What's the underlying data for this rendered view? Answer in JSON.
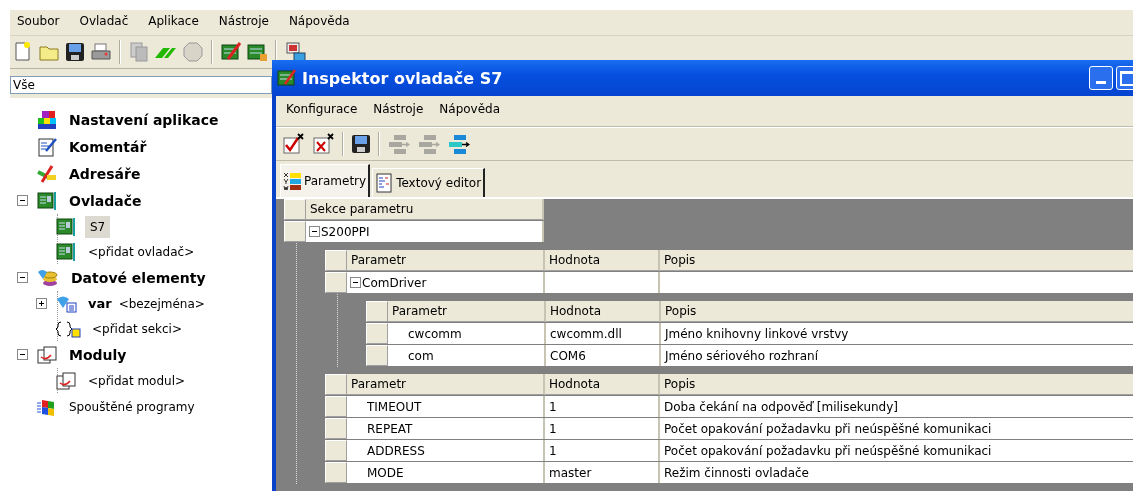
{
  "menu": [
    "Soubor",
    "Ovladač",
    "Aplikace",
    "Nástroje",
    "Nápověda"
  ],
  "toolbar": [
    {
      "kind": "new",
      "disabled": false
    },
    {
      "kind": "open",
      "disabled": false
    },
    {
      "kind": "save",
      "disabled": false
    },
    {
      "kind": "print",
      "disabled": false
    },
    {
      "kind": "separator"
    },
    {
      "kind": "copy",
      "disabled": true
    },
    {
      "kind": "run",
      "disabled": false
    },
    {
      "kind": "stop",
      "disabled": true
    },
    {
      "kind": "separator"
    },
    {
      "kind": "board-edit",
      "disabled": false
    },
    {
      "kind": "board-lock",
      "disabled": false
    },
    {
      "kind": "separator"
    },
    {
      "kind": "monitor",
      "disabled": false
    }
  ],
  "filter": {
    "value": "Vše"
  },
  "tree": [
    {
      "label": "Nastavení aplikace",
      "kind": "settings",
      "bold": true,
      "selected": false
    },
    {
      "label": "Komentář",
      "kind": "comment",
      "bold": true,
      "selected": false
    },
    {
      "label": "Adresáře",
      "kind": "directories",
      "bold": true,
      "selected": false
    },
    {
      "label": "Ovladače",
      "kind": "board",
      "bold": true,
      "selected": false,
      "expanded": true,
      "children": [
        {
          "label": "S7",
          "kind": "board",
          "bold": false,
          "selected": true
        },
        {
          "label": "<přidat ovladač>",
          "kind": "board",
          "bold": false,
          "selected": false
        }
      ]
    },
    {
      "label": "Datové elementy",
      "kind": "data",
      "bold": true,
      "selected": false,
      "expanded": true,
      "children": [
        {
          "label": "var",
          "note": "<bezejména>",
          "kind": "variable",
          "bold": true,
          "selected": false,
          "expanded": false
        },
        {
          "label": "<přidat sekci>",
          "kind": "section",
          "bold": false,
          "selected": false
        }
      ]
    },
    {
      "label": "Moduly",
      "kind": "module",
      "bold": true,
      "selected": false,
      "expanded": true,
      "children": [
        {
          "label": "<přidat modul>",
          "kind": "module",
          "bold": false,
          "selected": false
        }
      ]
    },
    {
      "label": "Spouštěné programy",
      "kind": "programs",
      "bold": false,
      "selected": false
    }
  ],
  "inspector": {
    "title": "Inspektor ovladače S7",
    "menu": [
      "Konfigurace",
      "Nástroje",
      "Nápověda"
    ],
    "toolbar": [
      {
        "kind": "check",
        "disabled": false
      },
      {
        "kind": "cross",
        "disabled": false
      },
      {
        "kind": "separator"
      },
      {
        "kind": "save",
        "disabled": false
      },
      {
        "kind": "separator"
      },
      {
        "kind": "move-left",
        "disabled": true
      },
      {
        "kind": "move-down",
        "disabled": true
      },
      {
        "kind": "move-right",
        "disabled": false
      }
    ],
    "tabs": [
      {
        "label": "Parametry",
        "kind": "params",
        "selected": true
      },
      {
        "label": "Textový editor",
        "kind": "text",
        "selected": false
      }
    ],
    "grid": {
      "columns": [
        "Sekce parametru"
      ],
      "rows": [
        {
          "name": "S200PPI",
          "expanded": true,
          "tables": [
            {
              "columns": [
                "Parametr",
                "Hodnota",
                "Popis"
              ],
              "rows": [
                {
                  "name": "ComDriver",
                  "expanded": true,
                  "tables": [
                    {
                      "columns": [
                        "Parametr",
                        "Hodnota",
                        "Popis"
                      ],
                      "rows": [
                        {
                          "name": "cwcomm",
                          "value": "cwcomm.dll",
                          "description": "Jméno knihovny linkové vrstvy"
                        },
                        {
                          "name": "com",
                          "value": "COM6",
                          "description": "Jméno sériového rozhraní"
                        }
                      ]
                    }
                  ]
                }
              ]
            },
            {
              "columns": [
                "Parametr",
                "Hodnota",
                "Popis"
              ],
              "rows": [
                {
                  "name": "TIMEOUT",
                  "value": "1",
                  "description": "Doba čekání na odpověď [milisekundy]"
                },
                {
                  "name": "REPEAT",
                  "value": "1",
                  "description": "Počet opakování požadavku při neúspěšné komunikaci"
                },
                {
                  "name": "ADDRESS",
                  "value": "1",
                  "description": "Počet opakování požadavku při neúspěšné komunikaci"
                },
                {
                  "name": "MODE",
                  "value": "master",
                  "description": "Režim činnosti ovladače"
                }
              ]
            }
          ]
        }
      ]
    }
  }
}
